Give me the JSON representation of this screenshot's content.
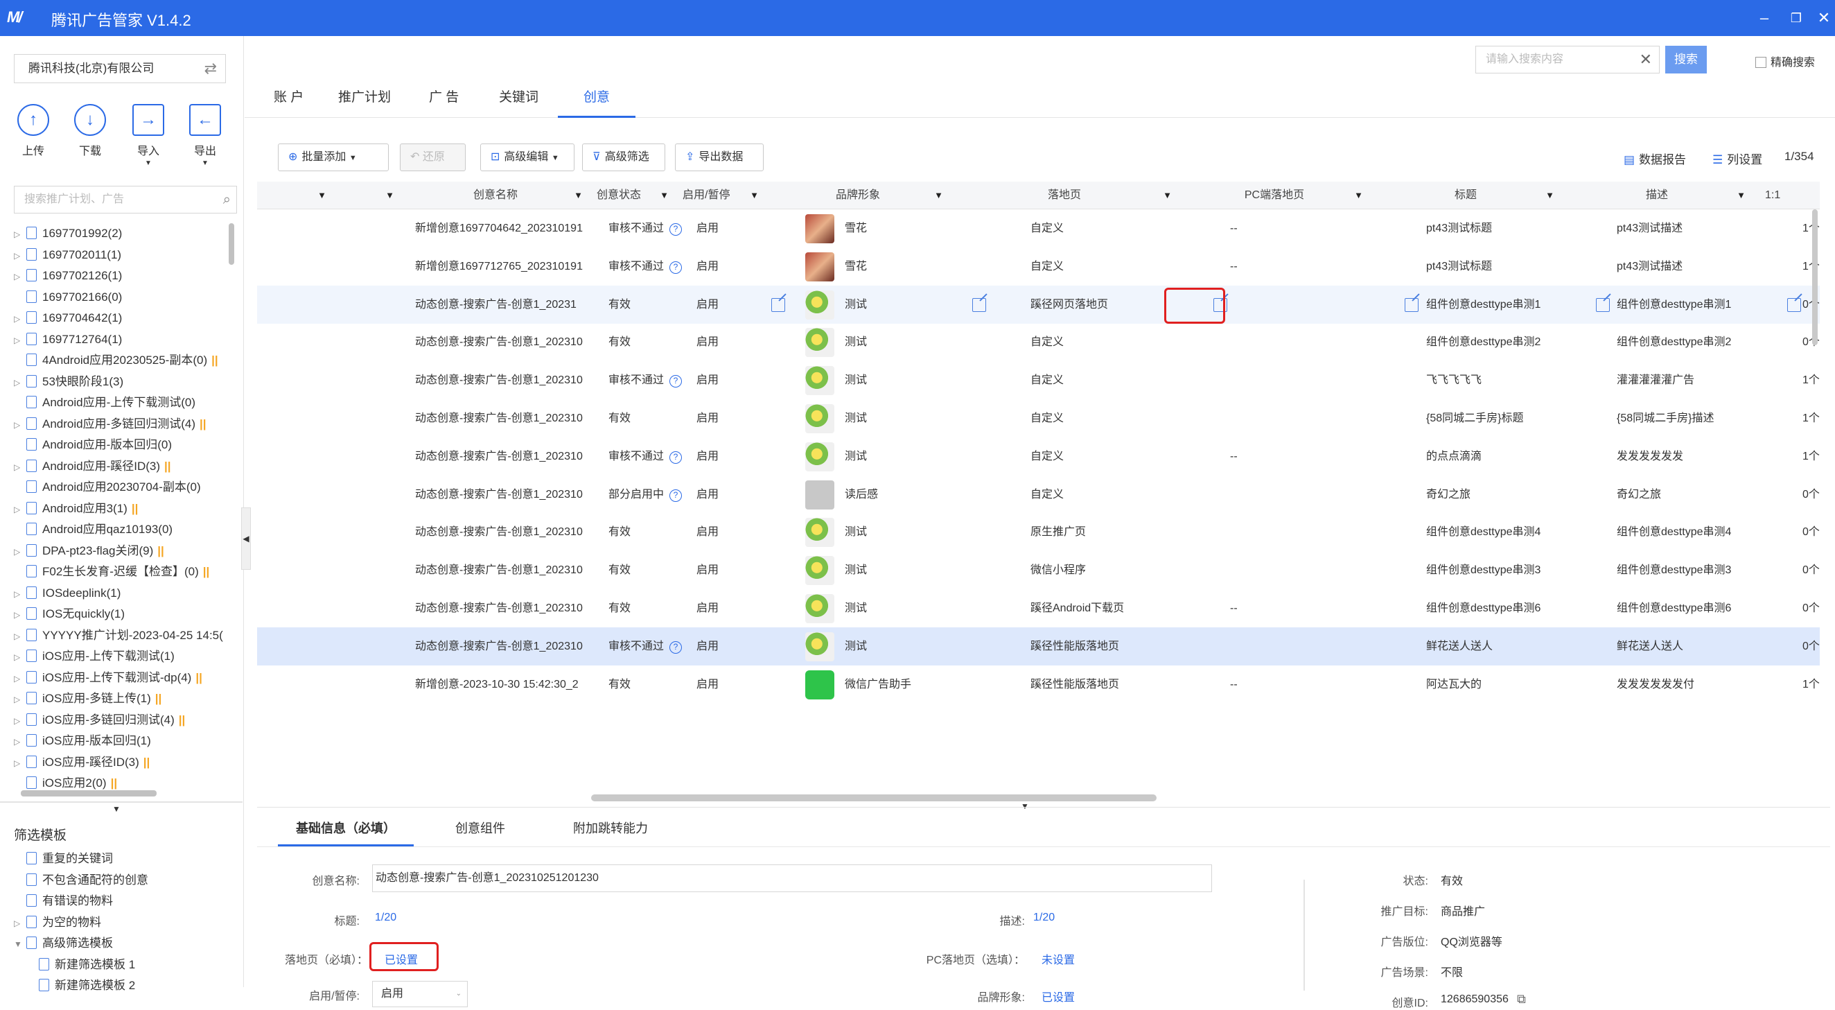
{
  "app": {
    "title": "腾讯广告管家 V1.4.2",
    "logo": "M/"
  },
  "sidebar": {
    "company": "腾讯科技(北京)有限公司",
    "actions": [
      {
        "label": "上传",
        "icon": "upload-icon",
        "glyph": "↑"
      },
      {
        "label": "下载",
        "icon": "download-icon",
        "glyph": "↓"
      },
      {
        "label": "导入",
        "icon": "import-icon",
        "glyph": "→"
      },
      {
        "label": "导出",
        "icon": "export-icon",
        "glyph": "←"
      }
    ],
    "search_placeholder": "搜索推广计划、广告",
    "tree": [
      {
        "label": "1697701992(2)",
        "arrow": true,
        "warn": false
      },
      {
        "label": "1697702011(1)",
        "arrow": true,
        "warn": false
      },
      {
        "label": "1697702126(1)",
        "arrow": true,
        "warn": false
      },
      {
        "label": "1697702166(0)",
        "arrow": false,
        "warn": false
      },
      {
        "label": "1697704642(1)",
        "arrow": true,
        "warn": false
      },
      {
        "label": "1697712764(1)",
        "arrow": true,
        "warn": false
      },
      {
        "label": "4Android应用20230525-副本(0)",
        "arrow": false,
        "warn": true
      },
      {
        "label": "53快眼阶段1(3)",
        "arrow": true,
        "warn": false
      },
      {
        "label": "Android应用-上传下载测试(0)",
        "arrow": false,
        "warn": false
      },
      {
        "label": "Android应用-多链回归测试(4)",
        "arrow": true,
        "warn": true
      },
      {
        "label": "Android应用-版本回归(0)",
        "arrow": false,
        "warn": false
      },
      {
        "label": "Android应用-蹊径ID(3)",
        "arrow": true,
        "warn": true
      },
      {
        "label": "Android应用20230704-副本(0)",
        "arrow": false,
        "warn": false
      },
      {
        "label": "Android应用3(1)",
        "arrow": true,
        "warn": true
      },
      {
        "label": "Android应用qaz10193(0)",
        "arrow": false,
        "warn": false
      },
      {
        "label": "DPA-pt23-flag关闭(9)",
        "arrow": true,
        "warn": true
      },
      {
        "label": "F02生长发育-迟缓【检查】(0)",
        "arrow": false,
        "warn": true
      },
      {
        "label": "IOSdeeplink(1)",
        "arrow": true,
        "warn": false
      },
      {
        "label": "IOS无quickly(1)",
        "arrow": true,
        "warn": false
      },
      {
        "label": "YYYYY推广计划-2023-04-25 14:5(",
        "arrow": true,
        "warn": false
      },
      {
        "label": "iOS应用-上传下载测试(1)",
        "arrow": true,
        "warn": false
      },
      {
        "label": "iOS应用-上传下载测试-dp(4)",
        "arrow": true,
        "warn": true
      },
      {
        "label": "iOS应用-多链上传(1)",
        "arrow": true,
        "warn": true
      },
      {
        "label": "iOS应用-多链回归测试(4)",
        "arrow": true,
        "warn": true
      },
      {
        "label": "iOS应用-版本回归(1)",
        "arrow": true,
        "warn": false
      },
      {
        "label": "iOS应用-蹊径ID(3)",
        "arrow": true,
        "warn": true
      },
      {
        "label": "iOS应用2(0)",
        "arrow": false,
        "warn": true
      }
    ],
    "filter_title": "筛选模板",
    "filters": [
      {
        "label": "重复的关键词",
        "arrow": false,
        "indent": false
      },
      {
        "label": "不包含通配符的创意",
        "arrow": false,
        "indent": false
      },
      {
        "label": "有错误的物料",
        "arrow": false,
        "indent": false
      },
      {
        "label": "为空的物料",
        "arrow": true,
        "indent": false
      },
      {
        "label": "高级筛选模板",
        "arrow": true,
        "indent": false
      },
      {
        "label": "新建筛选模板 1",
        "arrow": false,
        "indent": true
      },
      {
        "label": "新建筛选模板 2",
        "arrow": false,
        "indent": true
      }
    ]
  },
  "header": {
    "search_placeholder": "请输入搜索内容",
    "search_button": "搜索",
    "exact_label": "精确搜索"
  },
  "tabs": [
    {
      "label": "账 户"
    },
    {
      "label": "推广计划"
    },
    {
      "label": "广 告"
    },
    {
      "label": "关键词"
    },
    {
      "label": "创意"
    }
  ],
  "toolbar": {
    "batch_add": "批量添加",
    "restore": "还原",
    "adv_edit": "高级编辑",
    "adv_filter": "高级筛选",
    "export_data": "导出数据",
    "report": "数据报告",
    "col_settings": "列设置",
    "page": "1/354"
  },
  "columns": [
    "创意名称",
    "创意状态",
    "启用/暂停",
    "品牌形象",
    "落地页",
    "PC端落地页",
    "标题",
    "描述",
    "1:1"
  ],
  "rows": [
    {
      "name": "新增创意1697704642_202310191",
      "status": "审核不通过",
      "q": true,
      "enable": "启用",
      "thumb": "photo",
      "brand": "雪花",
      "landing": "自定义",
      "pc": "--",
      "title": "pt43测试标题",
      "desc": "pt43测试描述",
      "last": "1个"
    },
    {
      "name": "新增创意1697712765_202310191",
      "status": "审核不通过",
      "q": true,
      "enable": "启用",
      "thumb": "photo",
      "brand": "雪花",
      "landing": "自定义",
      "pc": "--",
      "title": "pt43测试标题",
      "desc": "pt43测试描述",
      "last": "1个"
    },
    {
      "name": "动态创意-搜索广告-创意1_20231",
      "status": "有效",
      "q": false,
      "enable": "启用",
      "thumb": "flower",
      "brand": "测试",
      "landing": "蹊径网页落地页",
      "pc": "",
      "title": "组件创意desttype串测1",
      "desc": "组件创意desttype串测1",
      "last": "0个",
      "edit": true
    },
    {
      "name": "动态创意-搜索广告-创意1_202310",
      "status": "有效",
      "q": false,
      "enable": "启用",
      "thumb": "flower",
      "brand": "测试",
      "landing": "自定义",
      "pc": "",
      "title": "组件创意desttype串测2",
      "desc": "组件创意desttype串测2",
      "last": "0个"
    },
    {
      "name": "动态创意-搜索广告-创意1_202310",
      "status": "审核不通过",
      "q": true,
      "enable": "启用",
      "thumb": "flower",
      "brand": "测试",
      "landing": "自定义",
      "pc": "",
      "title": "飞飞飞飞飞",
      "desc": "灌灌灌灌灌广告",
      "last": "1个"
    },
    {
      "name": "动态创意-搜索广告-创意1_202310",
      "status": "有效",
      "q": false,
      "enable": "启用",
      "thumb": "flower",
      "brand": "测试",
      "landing": "自定义",
      "pc": "",
      "title": "{58同城二手房}标题",
      "desc": "{58同城二手房}描述",
      "last": "1个"
    },
    {
      "name": "动态创意-搜索广告-创意1_202310",
      "status": "审核不通过",
      "q": true,
      "enable": "启用",
      "thumb": "flower",
      "brand": "测试",
      "landing": "自定义",
      "pc": "--",
      "title": "的点点滴滴",
      "desc": "发发发发发发",
      "last": "1个"
    },
    {
      "name": "动态创意-搜索广告-创意1_202310",
      "status": "部分启用中",
      "q": true,
      "enable": "启用",
      "thumb": "gray",
      "brand": "读后感",
      "landing": "自定义",
      "pc": "",
      "title": "奇幻之旅",
      "desc": "奇幻之旅",
      "last": "0个"
    },
    {
      "name": "动态创意-搜索广告-创意1_202310",
      "status": "有效",
      "q": false,
      "enable": "启用",
      "thumb": "flower",
      "brand": "测试",
      "landing": "原生推广页",
      "pc": "",
      "title": "组件创意desttype串测4",
      "desc": "组件创意desttype串测4",
      "last": "0个"
    },
    {
      "name": "动态创意-搜索广告-创意1_202310",
      "status": "有效",
      "q": false,
      "enable": "启用",
      "thumb": "flower",
      "brand": "测试",
      "landing": "微信小程序",
      "pc": "",
      "title": "组件创意desttype串测3",
      "desc": "组件创意desttype串测3",
      "last": "0个"
    },
    {
      "name": "动态创意-搜索广告-创意1_202310",
      "status": "有效",
      "q": false,
      "enable": "启用",
      "thumb": "flower",
      "brand": "测试",
      "landing": "蹊径Android下载页",
      "pc": "--",
      "title": "组件创意desttype串测6",
      "desc": "组件创意desttype串测6",
      "last": "0个"
    },
    {
      "name": "动态创意-搜索广告-创意1_202310",
      "status": "审核不通过",
      "q": true,
      "enable": "启用",
      "thumb": "flower",
      "brand": "测试",
      "landing": "蹊径性能版落地页",
      "pc": "",
      "title": "鲜花送人送人",
      "desc": "鲜花送人送人",
      "last": "0个"
    },
    {
      "name": "新增创意-2023-10-30 15:42:30_2",
      "status": "有效",
      "q": false,
      "enable": "启用",
      "thumb": "wechat",
      "brand": "微信广告助手",
      "landing": "蹊径性能版落地页",
      "pc": "--",
      "title": "阿达瓦大的",
      "desc": "发发发发发发付",
      "last": "1个"
    }
  ],
  "panel": {
    "tabs": [
      "基础信息（必填）",
      "创意组件",
      "附加跳转能力"
    ],
    "name_label": "创意名称:",
    "name_value": "动态创意-搜索广告-创意1_202310251201230",
    "title_label": "标题:",
    "title_value": "1/20",
    "desc_label": "描述:",
    "desc_value": "1/20",
    "landing_label": "落地页（必填）：",
    "landing_value": "已设置",
    "pc_label": "PC落地页（选填）：",
    "pc_value": "未设置",
    "enable_label": "启用/暂停:",
    "enable_value": "启用",
    "brand_label": "品牌形象:",
    "brand_value": "已设置",
    "status_label": "状态:",
    "status_value": "有效",
    "goal_label": "推广目标:",
    "goal_value": "商品推广",
    "slot_label": "广告版位:",
    "slot_value": "QQ浏览器等",
    "scene_label": "广告场景:",
    "scene_value": "不限",
    "id_label": "创意ID:",
    "id_value": "12686590356"
  }
}
